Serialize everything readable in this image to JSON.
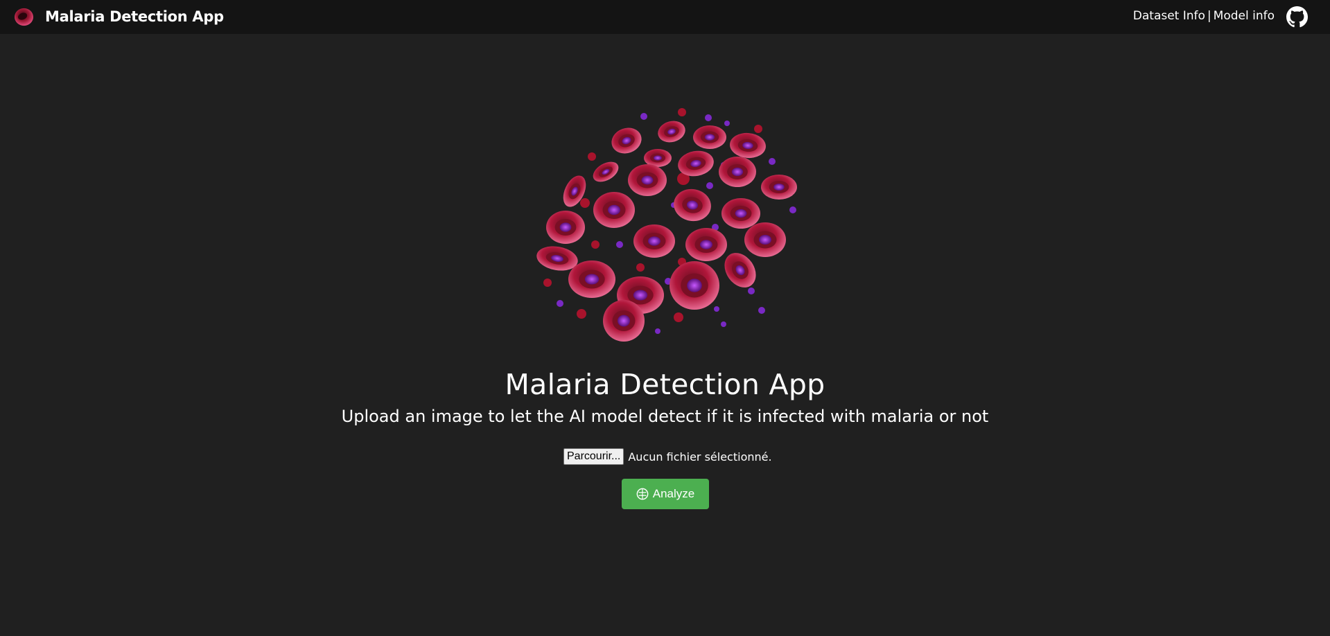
{
  "navbar": {
    "title": "Malaria Detection App",
    "links": {
      "dataset": "Dataset Info",
      "separator": "|",
      "model": "Model info"
    },
    "logo_icon": "red-blood-cell-logo",
    "github_icon": "github-icon"
  },
  "hero": {
    "image_icon": "blood-cells-illustration",
    "title": "Malaria Detection App",
    "subtitle": "Upload an image to let the AI model detect if it is infected with malaria or not"
  },
  "upload": {
    "browse_label": "Parcourir...",
    "status_text": "Aucun fichier sélectionné."
  },
  "analyze": {
    "label": "Analyze",
    "icon": "brain-icon"
  },
  "colors": {
    "background": "#202020",
    "navbar": "#141414",
    "accent_green": "#4caf50",
    "cell_red": "#b0163a",
    "cell_purple": "#8a2be2"
  }
}
